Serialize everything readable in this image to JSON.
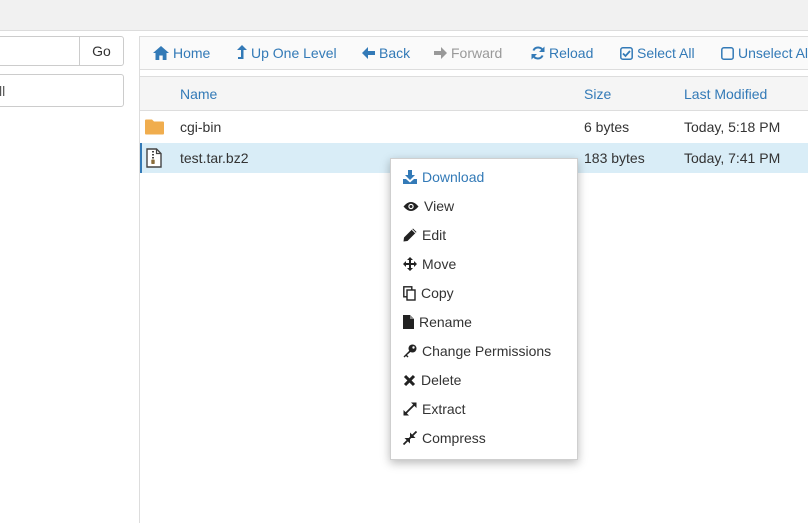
{
  "left_panel": {
    "search": {
      "value": "",
      "go_label": "Go"
    },
    "directory_value": "ll"
  },
  "toolbar": {
    "home": "Home",
    "up_one_level": "Up One Level",
    "back": "Back",
    "forward": "Forward",
    "reload": "Reload",
    "select_all": "Select All",
    "unselect_all": "Unselect All"
  },
  "table": {
    "columns": {
      "name": "Name",
      "size": "Size",
      "last_modified": "Last Modified"
    },
    "rows": [
      {
        "icon": "folder-icon",
        "name": "cgi-bin",
        "size": "6 bytes",
        "modified": "Today, 5:18 PM",
        "selected": false
      },
      {
        "icon": "archive-file-icon",
        "name": "test.tar.bz2",
        "size": "183 bytes",
        "modified": "Today, 7:41 PM",
        "selected": true
      }
    ]
  },
  "context_menu": {
    "items": [
      {
        "label": "Download",
        "icon": "download-icon"
      },
      {
        "label": "View",
        "icon": "eye-icon"
      },
      {
        "label": "Edit",
        "icon": "pencil-icon"
      },
      {
        "label": "Move",
        "icon": "move-arrows-icon"
      },
      {
        "label": "Copy",
        "icon": "copy-icon"
      },
      {
        "label": "Rename",
        "icon": "file-icon"
      },
      {
        "label": "Change Permissions",
        "icon": "key-icon"
      },
      {
        "label": "Delete",
        "icon": "x-icon"
      },
      {
        "label": "Extract",
        "icon": "expand-icon"
      },
      {
        "label": "Compress",
        "icon": "compress-icon"
      }
    ]
  },
  "colors": {
    "link": "#337ab7",
    "disabled": "#999999",
    "selected_row": "#d9edf7",
    "folder": "#f0ad4e",
    "topbar": "#f1f1f1"
  }
}
